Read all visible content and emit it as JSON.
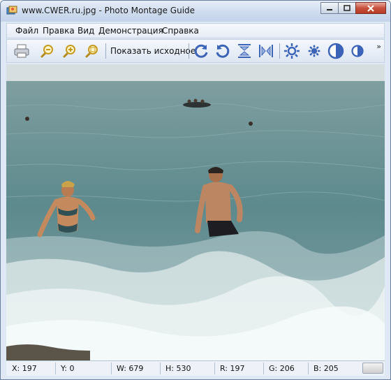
{
  "window": {
    "title": "www.CWER.ru.jpg - Photo Montage Guide"
  },
  "menu": [
    {
      "label": "Файл"
    },
    {
      "label": "Правка"
    },
    {
      "label": "Вид"
    },
    {
      "label": "Демонстрация"
    },
    {
      "label": "Справка"
    }
  ],
  "toolbar": {
    "show_original_label": "Показать исходное",
    "more_label": "»",
    "icons": [
      "printer-icon",
      "zoom-out-icon",
      "zoom-in-icon",
      "zoom-fit-icon",
      "rotate-right-icon",
      "rotate-left-icon",
      "flip-vertical-icon",
      "flip-horizontal-icon",
      "brightness-up-icon",
      "brightness-down-icon",
      "contrast-up-icon",
      "contrast-down-icon"
    ]
  },
  "status": {
    "x": "X: 197",
    "y": "Y: 0",
    "w": "W: 679",
    "h": "H: 530",
    "r": "R: 197",
    "g": "G: 206",
    "b": "B: 205"
  },
  "colors": {
    "sea": "#5c8a8f",
    "sky": "#d7dedf",
    "accent": "#3b63b8"
  }
}
